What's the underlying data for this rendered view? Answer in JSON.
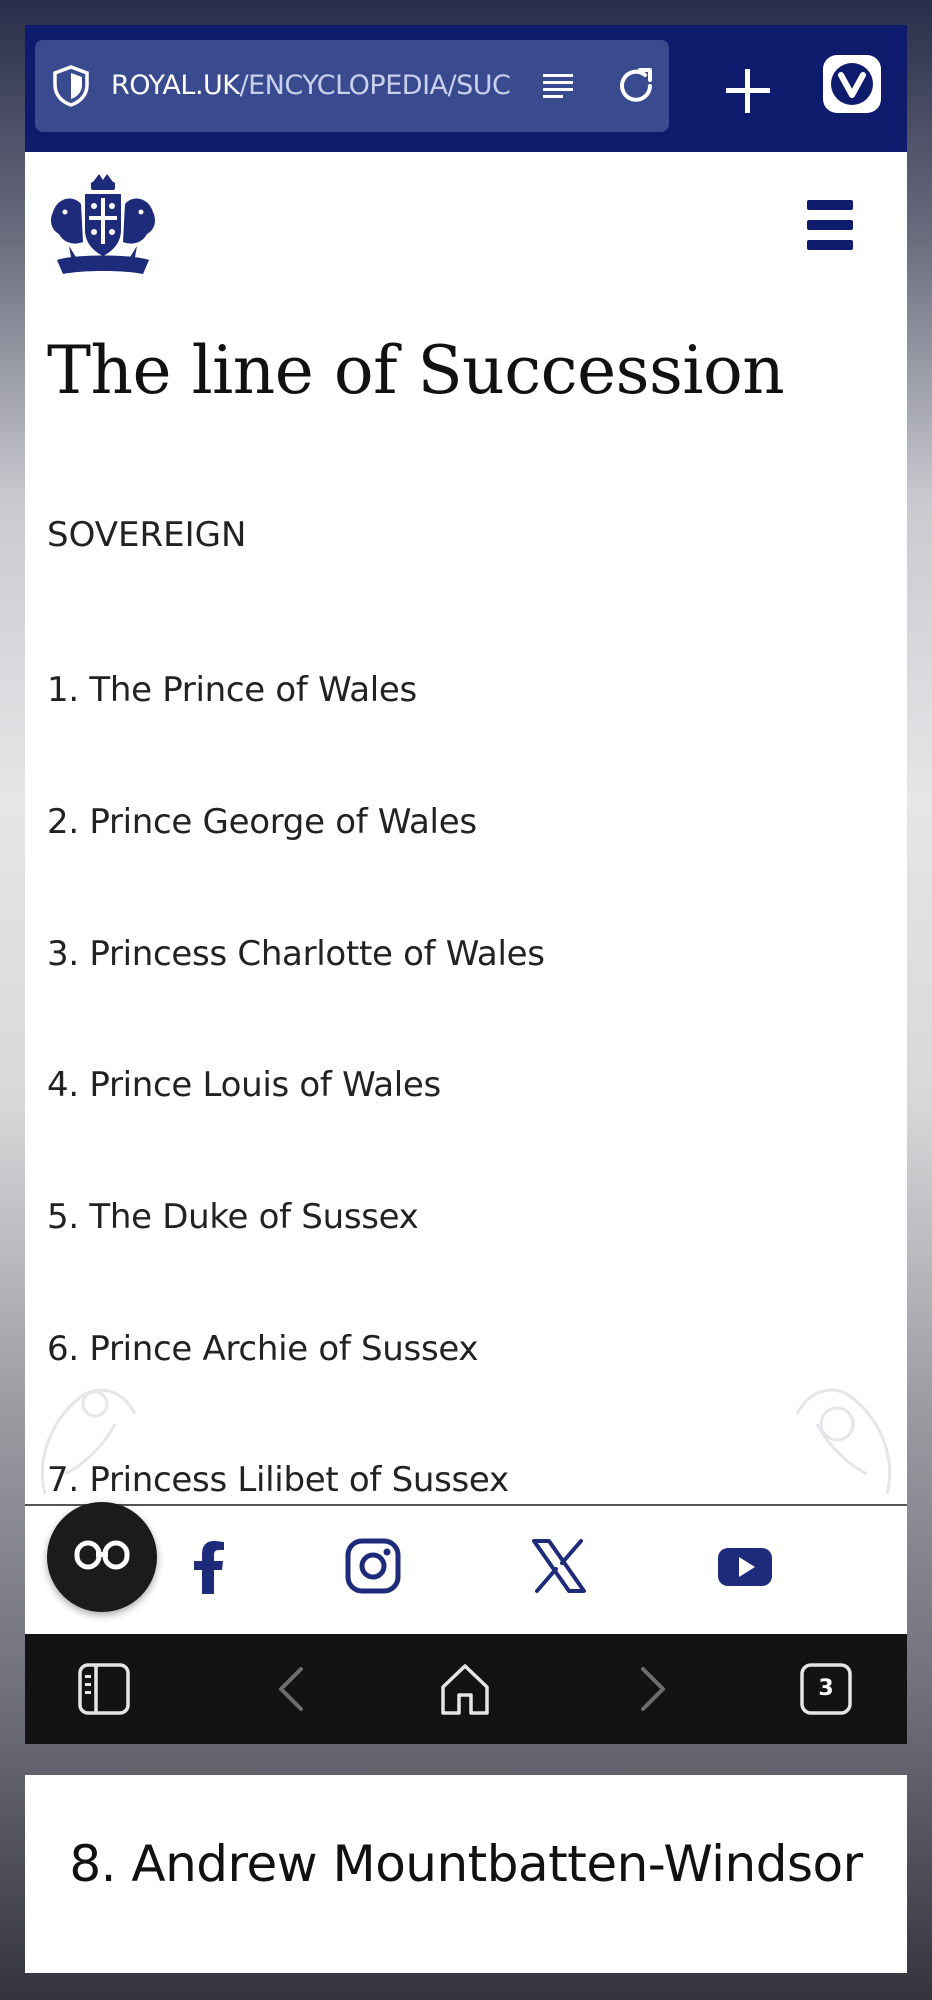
{
  "browser": {
    "url_host": "ROYAL.UK",
    "url_path": "/ENCYCLOPEDIA/SUCCESSION",
    "tab_count": "3"
  },
  "page": {
    "title": "The line of Succession",
    "sovereign_label": "SOVEREIGN",
    "succession": [
      "1. The Prince of Wales",
      "2. Prince George of Wales",
      "3. Princess Charlotte of Wales",
      "4. Prince Louis of Wales",
      "5. The Duke of Sussex",
      "6. Prince Archie of Sussex",
      "7. Princess Lilibet of Sussex"
    ]
  },
  "social": [
    "facebook-icon",
    "instagram-icon",
    "x-icon",
    "youtube-icon"
  ],
  "toast": {
    "text": "8. Andrew Mountbatten-Windsor"
  },
  "colors": {
    "brand_navy": "#0f1c6e",
    "urlbar": "#3a4a8e",
    "nav_bar": "#131313"
  }
}
